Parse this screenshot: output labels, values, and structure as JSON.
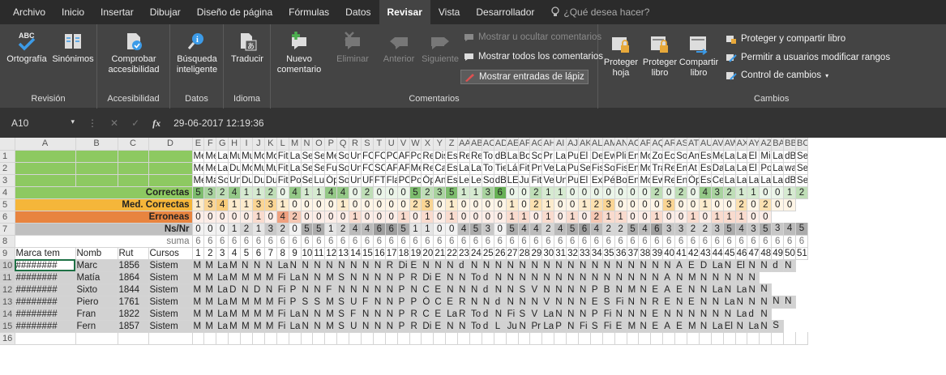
{
  "menu": {
    "tabs": [
      "Archivo",
      "Inicio",
      "Insertar",
      "Dibujar",
      "Diseño de página",
      "Fórmulas",
      "Datos",
      "Revisar",
      "Vista",
      "Desarrollador"
    ],
    "active": "Revisar",
    "tell_me": "¿Qué desea hacer?"
  },
  "ribbon": {
    "revision": {
      "label": "Revisión",
      "ortografia": "Ortografía",
      "sinonimos": "Sinónimos"
    },
    "accesibilidad": {
      "label": "Accesibilidad",
      "comprobar": "Comprobar accesibilidad"
    },
    "datos": {
      "label": "Datos",
      "busqueda": "Búsqueda inteligente"
    },
    "idioma": {
      "label": "Idioma",
      "traducir": "Traducir"
    },
    "comentarios": {
      "label": "Comentarios",
      "nuevo": "Nuevo comentario",
      "eliminar": "Eliminar",
      "anterior": "Anterior",
      "siguiente": "Siguiente",
      "mostrar_ocultar": "Mostrar u ocultar comentarios",
      "mostrar_todos": "Mostrar todos los comentarios",
      "mostrar_lapiz": "Mostrar entradas de lápiz"
    },
    "cambios": {
      "label": "Cambios",
      "proteger_hoja": "Proteger hoja",
      "proteger_libro": "Proteger libro",
      "compartir_libro": "Compartir libro",
      "proteger_compartir": "Proteger y compartir libro",
      "permitir": "Permitir a usuarios modificar rangos",
      "control": "Control de cambios"
    }
  },
  "formula_bar": {
    "cell": "A10",
    "fx": "fx",
    "value": "29-06-2017 12:19:36"
  },
  "columns": [
    "A",
    "B",
    "C",
    "D",
    "E",
    "F",
    "G",
    "H",
    "I",
    "J",
    "K",
    "L",
    "M",
    "N",
    "O",
    "P",
    "Q",
    "R",
    "S",
    "T",
    "U",
    "V",
    "W",
    "X",
    "Y",
    "Z",
    "AA",
    "AB",
    "AC",
    "AD",
    "AE",
    "AF",
    "AG",
    "AH",
    "AI",
    "AJ",
    "AK",
    "AL",
    "AM",
    "AN",
    "AO",
    "AP",
    "AQ",
    "AR",
    "AS",
    "AT",
    "AU",
    "AV",
    "AW",
    "AX",
    "AY",
    "AZ",
    "BA",
    "BB",
    "BC"
  ],
  "row_numbers": [
    "1",
    "2",
    "3",
    "4",
    "5",
    "6",
    "7",
    "8",
    "9",
    "10",
    "11",
    "12",
    "13",
    "14",
    "15",
    "16"
  ],
  "header_rows": [
    [
      "Me",
      "Me",
      "La",
      "Mu",
      "Mu",
      "Mc",
      "Mc",
      "Fit",
      "La",
      "Se",
      "Se",
      "Me",
      "So",
      "Un",
      "FC",
      "FC",
      "PC",
      "AF",
      "Po",
      "Re",
      "Dis",
      "Es",
      "Re",
      "Re",
      "To",
      "dB",
      "La",
      "Bo",
      "So",
      "Pr",
      "La",
      "Pu",
      "El",
      "De",
      "Ew",
      "Pli",
      "En",
      "Mc",
      "Zo",
      "Ec",
      "So",
      "An",
      "Es",
      "Me",
      "La",
      "La",
      "El",
      "Mi",
      "La",
      "dB",
      "Se"
    ],
    [
      "Me",
      "Me",
      "La",
      "Du",
      "Mc",
      "Mu",
      "Mu",
      "Fit",
      "La",
      "Se",
      "Se",
      "Fu",
      "So",
      "Un",
      "FC",
      "SC",
      "AF",
      "AF",
      "Me",
      "Re",
      "Ca",
      "Es",
      "La",
      "La",
      "To",
      "Tie",
      "Lá",
      "Fit",
      "Pn",
      "Ve",
      "La",
      "Pu",
      "Se",
      "Fis",
      "So",
      "Fis",
      "En",
      "Mc",
      "Tra",
      "Re",
      "En",
      "At",
      "Es",
      "Da",
      "La",
      "La",
      "El",
      "Po",
      "La",
      "wa",
      "Se"
    ],
    [
      "Me",
      "Ma",
      "So",
      "Un",
      "Du",
      "Du",
      "Du",
      "Fit",
      "Po",
      "Se",
      "Lu",
      "Óp",
      "So",
      "Un",
      "UF",
      "FT",
      "Fla",
      "PC",
      "Po",
      "Óp",
      "An",
      "Es",
      "Le",
      "Le",
      "So",
      "dB",
      "LE",
      "Ju",
      "Fit",
      "Ve",
      "Un",
      "Pu",
      "El",
      "Ex",
      "Pé",
      "Bo",
      "En",
      "Mc",
      "Ew",
      "Re",
      "En",
      "Óp",
      "Es",
      "Ce",
      "La",
      "La",
      "La",
      "La",
      "La",
      "dB",
      "Se"
    ]
  ],
  "labels": {
    "correctas": "Correctas",
    "med_correctas": "Med. Correctas",
    "erroneas": "Erroneas",
    "nsnr": "Ns/Nr",
    "suma": "suma"
  },
  "correctas": [
    "5",
    "3",
    "2",
    "4",
    "1",
    "1",
    "2",
    "0",
    "4",
    "1",
    "1",
    "4",
    "4",
    "0",
    "2",
    "0",
    "0",
    "0",
    "5",
    "2",
    "3",
    "5",
    "1",
    "1",
    "3",
    "6",
    "0",
    "0",
    "2",
    "1",
    "1",
    "0",
    "0",
    "0",
    "0",
    "0",
    "0",
    "0",
    "2",
    "0",
    "2",
    "0",
    "4",
    "3",
    "2",
    "1",
    "1",
    "0",
    "0",
    "1",
    "2",
    "1"
  ],
  "med_correctas": [
    "1",
    "3",
    "4",
    "1",
    "1",
    "3",
    "3",
    "1",
    "0",
    "0",
    "0",
    "0",
    "1",
    "0",
    "0",
    "0",
    "0",
    "0",
    "2",
    "3",
    "0",
    "1",
    "0",
    "0",
    "0",
    "0",
    "1",
    "0",
    "2",
    "1",
    "0",
    "0",
    "1",
    "2",
    "3",
    "0",
    "0",
    "0",
    "0",
    "3",
    "0",
    "0",
    "1",
    "0",
    "0",
    "2",
    "0",
    "2",
    "0",
    "0"
  ],
  "erroneas": [
    "0",
    "0",
    "0",
    "0",
    "0",
    "1",
    "0",
    "4",
    "2",
    "0",
    "0",
    "0",
    "0",
    "1",
    "0",
    "0",
    "0",
    "1",
    "0",
    "1",
    "0",
    "1",
    "0",
    "0",
    "0",
    "0",
    "1",
    "1",
    "0",
    "1",
    "0",
    "1",
    "0",
    "2",
    "1",
    "1",
    "0",
    "0",
    "1",
    "0",
    "0",
    "1",
    "0",
    "1",
    "1",
    "1",
    "0",
    "0"
  ],
  "nsnr": [
    "0",
    "0",
    "0",
    "1",
    "2",
    "1",
    "3",
    "2",
    "0",
    "5",
    "5",
    "1",
    "2",
    "4",
    "4",
    "6",
    "6",
    "5",
    "1",
    "1",
    "0",
    "0",
    "4",
    "5",
    "3",
    "0",
    "5",
    "4",
    "4",
    "2",
    "4",
    "5",
    "6",
    "4",
    "2",
    "2",
    "5",
    "4",
    "6",
    "3",
    "3",
    "2",
    "2",
    "3",
    "5",
    "4",
    "3",
    "5",
    "3",
    "4",
    "5"
  ],
  "suma": [
    "6",
    "6",
    "6",
    "6",
    "6",
    "6",
    "6",
    "6",
    "6",
    "6",
    "6",
    "6",
    "6",
    "6",
    "6",
    "6",
    "6",
    "6",
    "6",
    "6",
    "6",
    "6",
    "6",
    "6",
    "6",
    "6",
    "6",
    "6",
    "6",
    "6",
    "6",
    "6",
    "6",
    "6",
    "6",
    "6",
    "6",
    "6",
    "6",
    "6",
    "6",
    "6",
    "6",
    "6",
    "6",
    "6",
    "6",
    "6",
    "6",
    "6",
    "6"
  ],
  "row9": {
    "a": "Marca tem",
    "b": "Nomb",
    "c": "Rut",
    "d": "Cursos",
    "nums": [
      "1",
      "2",
      "3",
      "4",
      "5",
      "6",
      "7",
      "8",
      "9",
      "10",
      "11",
      "12",
      "13",
      "14",
      "15",
      "16",
      "17",
      "18",
      "19",
      "20",
      "21",
      "22",
      "23",
      "24",
      "25",
      "26",
      "27",
      "28",
      "29",
      "30",
      "31",
      "32",
      "33",
      "34",
      "35",
      "36",
      "37",
      "38",
      "39",
      "40",
      "41",
      "42",
      "43",
      "44",
      "45",
      "46",
      "47",
      "48",
      "49",
      "50",
      "51"
    ]
  },
  "data_rows": [
    {
      "a": "########",
      "b": "Marc",
      "c": "1856",
      "d": "Sistem",
      "v": [
        "M",
        "M",
        "La",
        "M",
        "N",
        "N",
        "N",
        "La",
        "N",
        "N",
        "N",
        "N",
        "N",
        "N",
        "N",
        "N",
        "R",
        "Di",
        "E",
        "N",
        "N",
        "N",
        "d",
        "N",
        "N",
        "N",
        "N",
        "N",
        "N",
        "N",
        "N",
        "N",
        "N",
        "N",
        "N",
        "N",
        "N",
        "N",
        "N",
        "N",
        "A",
        "E",
        "D",
        "La",
        "N",
        "El",
        "N",
        "N",
        "d",
        "N"
      ]
    },
    {
      "a": "########",
      "b": "Matía",
      "c": "1864",
      "d": "Sistem",
      "v": [
        "M",
        "M",
        "La",
        "M",
        "M",
        "M",
        "M",
        "Fi",
        "La",
        "N",
        "N",
        "M",
        "S",
        "N",
        "N",
        "N",
        "N",
        "P",
        "R",
        "Di",
        "E",
        "N",
        "N",
        "To",
        "d",
        "N",
        "N",
        "N",
        "N",
        "N",
        "N",
        "N",
        "N",
        "N",
        "N",
        "N",
        "N",
        "N",
        "N",
        "A",
        "N",
        "M",
        "N",
        "N",
        "N",
        "N",
        "N"
      ]
    },
    {
      "a": "########",
      "b": "Sixto",
      "c": "1844",
      "d": "Sistem",
      "v": [
        "M",
        "M",
        "La",
        "D",
        "N",
        "D",
        "N",
        "Fi",
        "P",
        "N",
        "N",
        "F",
        "N",
        "N",
        "N",
        "N",
        "N",
        "P",
        "N",
        "C",
        "E",
        "N",
        "N",
        "N",
        "d",
        "N",
        "N",
        "S",
        "V",
        "N",
        "N",
        "N",
        "N",
        "P",
        "B",
        "N",
        "M",
        "N",
        "E",
        "A",
        "E",
        "N",
        "N",
        "La",
        "N",
        "La",
        "N",
        "N"
      ]
    },
    {
      "a": "########",
      "b": "Piero",
      "c": "1761",
      "d": "Sistem",
      "v": [
        "M",
        "M",
        "La",
        "M",
        "M",
        "M",
        "M",
        "Fi",
        "P",
        "S",
        "S",
        "M",
        "S",
        "U",
        "F",
        "N",
        "N",
        "P",
        "P",
        "Ó",
        "C",
        "E",
        "R",
        "N",
        "N",
        "d",
        "N",
        "N",
        "N",
        "V",
        "N",
        "N",
        "N",
        "E",
        "S",
        "Fi",
        "N",
        "N",
        "R",
        "E",
        "N",
        "E",
        "N",
        "N",
        "La",
        "N",
        "N",
        "N",
        "N",
        "N"
      ]
    },
    {
      "a": "########",
      "b": "Fran",
      "c": "1822",
      "d": "Sistem",
      "v": [
        "M",
        "M",
        "La",
        "M",
        "M",
        "M",
        "M",
        "Fi",
        "La",
        "N",
        "N",
        "M",
        "S",
        "F",
        "N",
        "N",
        "N",
        "P",
        "R",
        "C",
        "E",
        "La",
        "R",
        "To",
        "d",
        "N",
        "Fi",
        "S",
        "V",
        "La",
        "N",
        "N",
        "N",
        "P",
        "Fi",
        "N",
        "N",
        "N",
        "E",
        "N",
        "N",
        "N",
        "N",
        "N",
        "N",
        "La",
        "d",
        "N"
      ]
    },
    {
      "a": "########",
      "b": "Fern",
      "c": "1857",
      "d": "Sistem",
      "v": [
        "M",
        "M",
        "La",
        "M",
        "M",
        "M",
        "M",
        "Fi",
        "La",
        "N",
        "N",
        "M",
        "S",
        "U",
        "N",
        "N",
        "N",
        "P",
        "R",
        "Di",
        "E",
        "N",
        "N",
        "To",
        "d",
        "L",
        "Ju",
        "N",
        "Pr",
        "La",
        "P",
        "N",
        "Fi",
        "S",
        "Fi",
        "E",
        "M",
        "N",
        "E",
        "A",
        "E",
        "M",
        "N",
        "La",
        "El",
        "N",
        "La",
        "N",
        "S"
      ]
    }
  ]
}
